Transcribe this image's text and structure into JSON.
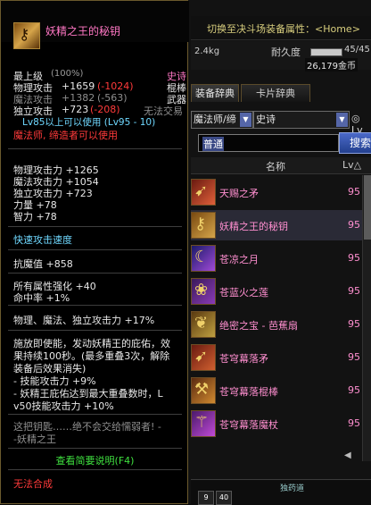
{
  "background": {
    "switch_label": "切换至决斗场装备属性：<Home>",
    "weight": "2.4kg",
    "durability_label": "耐久度",
    "durability_value": "45/45",
    "durability_fraction": 1.0,
    "gold": "26,179金币",
    "tabs": [
      "装备辞典",
      "卡片辞典"
    ],
    "filter_class": "魔法师/缔",
    "filter_rarity": "史诗",
    "lv_label": "Lv",
    "search_value": "普通",
    "search_button": "搜索",
    "col_name": "名称",
    "col_lv": "Lv△",
    "items": [
      {
        "name": "天赐之矛",
        "lv": "95",
        "icon": "spear-icon",
        "selected": false
      },
      {
        "name": "妖精之王的秘钥",
        "lv": "95",
        "icon": "key-icon",
        "selected": true
      },
      {
        "name": "苍凉之月",
        "lv": "95",
        "icon": "moon-icon",
        "selected": false
      },
      {
        "name": "苍蓝火之莲",
        "lv": "95",
        "icon": "lotus-icon",
        "selected": false
      },
      {
        "name": "绝密之宝 - 芭蕉扇",
        "lv": "95",
        "icon": "fan-icon",
        "selected": false
      },
      {
        "name": "苍穹幕落矛",
        "lv": "95",
        "icon": "spear-icon",
        "selected": false
      },
      {
        "name": "苍穹幕落棍棒",
        "lv": "95",
        "icon": "club-icon",
        "selected": false
      },
      {
        "name": "苍穹幕落魔杖",
        "lv": "95",
        "icon": "wand-icon",
        "selected": false
      }
    ],
    "bottom": {
      "slot1": "9",
      "slot2": "40",
      "label": "独药道"
    }
  },
  "tooltip": {
    "title": "妖精之王的秘钥",
    "icon": "key-icon",
    "grade_label": "最上级",
    "grade_pct": "(100%)",
    "rarity": "史诗",
    "phys_atk_label": "物理攻击",
    "phys_atk_value": "+1659",
    "phys_atk_delta": "(-1024)",
    "type": "棍棒",
    "mag_atk_label": "魔法攻击",
    "mag_atk_value": "+1382",
    "mag_atk_delta": "(-563)",
    "slot": "武器",
    "ind_atk_label": "独立攻击",
    "ind_atk_value": "+723",
    "ind_atk_delta": "(-208)",
    "trade": "无法交易",
    "level_req": "Lv85以上可以使用 (Lv95 - 10)",
    "class_req": "魔法师, 缔造者可以使用",
    "stats": [
      "物理攻击力 +1265",
      "魔法攻击力 +1054",
      "独立攻击力 +723",
      "力量 +78",
      "智力 +78"
    ],
    "speed": "快速攻击速度",
    "resist": "抗魔值 +858",
    "elem": "所有属性强化 +40",
    "hit": "命中率 +1%",
    "atk_pct": "物理、魔法、独立攻击力 +17%",
    "effect_lines": [
      "施放即使能，发动妖精王的庇佑，效",
      "果持续100秒。(最多重叠3次，解除",
      "装备后效果消失)",
      "- 技能攻击力 +9%",
      "- 妖精王庇佑达到最大重叠数时，L",
      "v50技能攻击力 +10%"
    ],
    "flavor_lines": [
      "这把钥匙……绝不会交给懦弱者! -",
      "-妖精之王"
    ],
    "brief_link": "查看简要说明(F4)",
    "no_compose": "无法合成"
  }
}
